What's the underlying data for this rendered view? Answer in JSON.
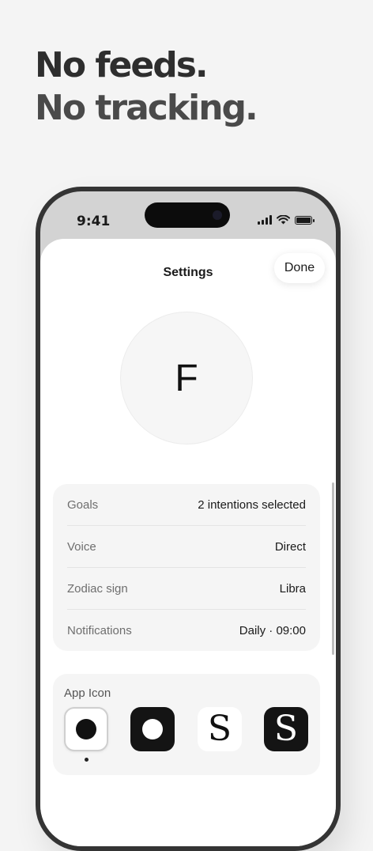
{
  "headline": {
    "line1": "No feeds.",
    "line2": "No tracking."
  },
  "status_bar": {
    "time": "9:41"
  },
  "settings": {
    "title": "Settings",
    "done_label": "Done",
    "avatar_initial": "F",
    "rows": [
      {
        "label": "Goals",
        "value": "2 intentions selected"
      },
      {
        "label": "Voice",
        "value": "Direct"
      },
      {
        "label": "Zodiac sign",
        "value": "Libra"
      },
      {
        "label": "Notifications",
        "value": "Daily · 09:00"
      }
    ]
  },
  "app_icon": {
    "title": "App Icon",
    "options": [
      {
        "glyph": "",
        "style": "light-dot",
        "selected": true
      },
      {
        "glyph": "",
        "style": "dark-dot",
        "selected": false
      },
      {
        "glyph": "S",
        "style": "light-serif",
        "selected": false
      },
      {
        "glyph": "S",
        "style": "dark-serif",
        "selected": false
      }
    ]
  }
}
